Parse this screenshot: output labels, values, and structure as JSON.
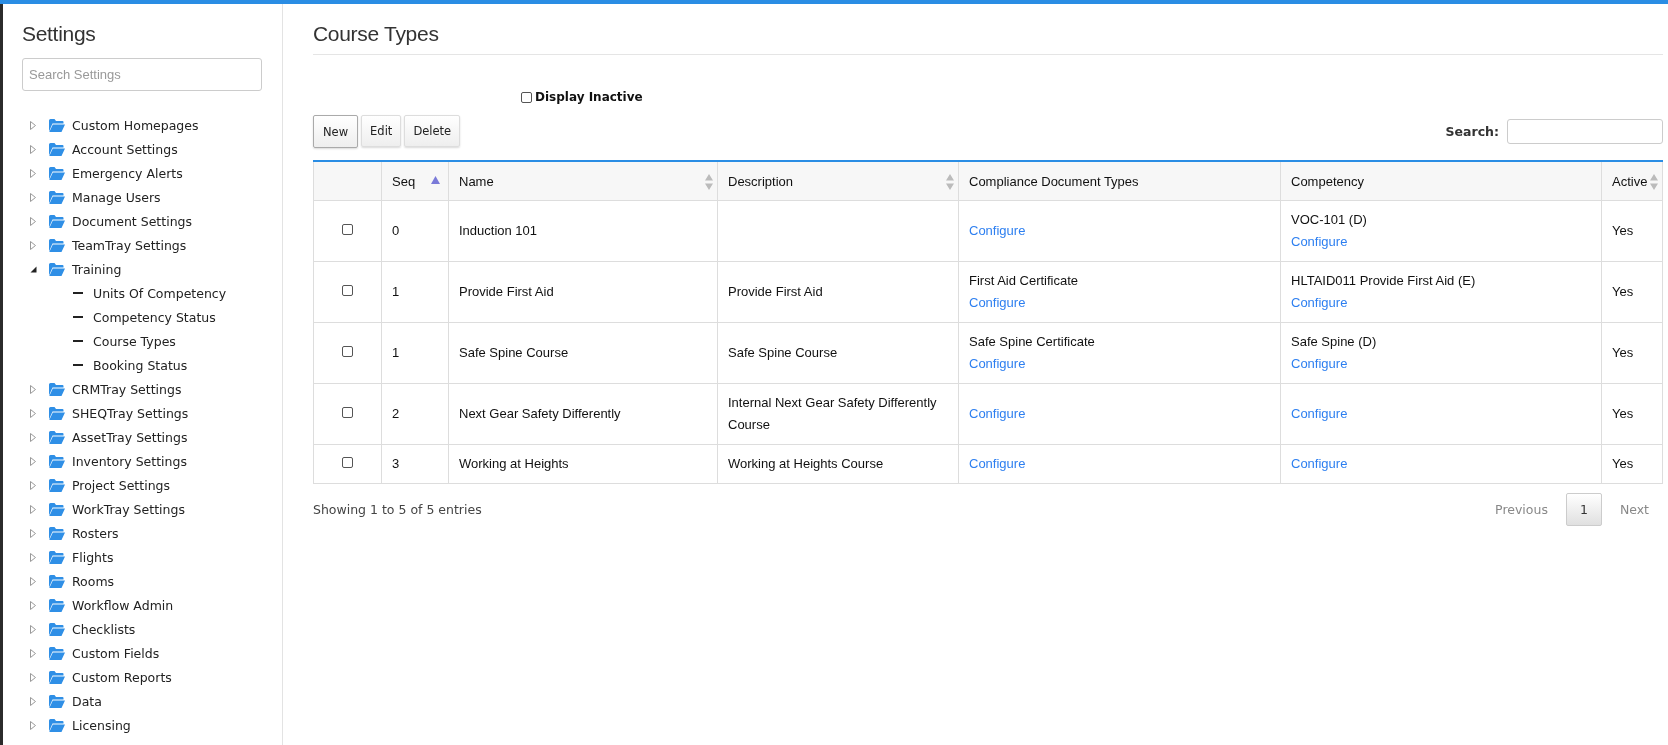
{
  "sidebar": {
    "title": "Settings",
    "search": {
      "placeholder": "Search Settings"
    },
    "items": [
      {
        "label": "Custom Homepages",
        "expanded": false
      },
      {
        "label": "Account Settings",
        "expanded": false
      },
      {
        "label": "Emergency Alerts",
        "expanded": false
      },
      {
        "label": "Manage Users",
        "expanded": false
      },
      {
        "label": "Document Settings",
        "expanded": false
      },
      {
        "label": "TeamTray Settings",
        "expanded": false
      },
      {
        "label": "Training",
        "expanded": true,
        "children": [
          {
            "label": "Units Of Competency"
          },
          {
            "label": "Competency Status"
          },
          {
            "label": "Course Types"
          },
          {
            "label": "Booking Status"
          }
        ]
      },
      {
        "label": "CRMTray Settings",
        "expanded": false
      },
      {
        "label": "SHEQTray Settings",
        "expanded": false
      },
      {
        "label": "AssetTray Settings",
        "expanded": false
      },
      {
        "label": "Inventory Settings",
        "expanded": false
      },
      {
        "label": "Project Settings",
        "expanded": false
      },
      {
        "label": "WorkTray Settings",
        "expanded": false
      },
      {
        "label": "Rosters",
        "expanded": false
      },
      {
        "label": "Flights",
        "expanded": false
      },
      {
        "label": "Rooms",
        "expanded": false
      },
      {
        "label": "Workflow Admin",
        "expanded": false
      },
      {
        "label": "Checklists",
        "expanded": false
      },
      {
        "label": "Custom Fields",
        "expanded": false
      },
      {
        "label": "Custom Reports",
        "expanded": false
      },
      {
        "label": "Data",
        "expanded": false
      },
      {
        "label": "Licensing",
        "expanded": false
      }
    ]
  },
  "main": {
    "title": "Course Types",
    "display_inactive": {
      "label": "Display Inactive",
      "checked": false
    },
    "buttons": [
      "New",
      "Edit",
      "Delete"
    ],
    "search": {
      "label": "Search:"
    },
    "table": {
      "columns": [
        {
          "sortable": false,
          "sorted": false
        },
        {
          "label": "Seq",
          "sortable": true,
          "sorted": true
        },
        {
          "label": "Name",
          "sortable": true,
          "sorted": false
        },
        {
          "label": "Description",
          "sortable": true,
          "sorted": false
        },
        {
          "label": "Compliance Document Types",
          "sortable": false,
          "sorted": false
        },
        {
          "label": "Competency",
          "sortable": false,
          "sorted": false
        },
        {
          "label": "Active",
          "sortable": true,
          "sorted": false
        }
      ],
      "rows": [
        {
          "selected": false,
          "seq": "0",
          "name": "Induction 101",
          "compliance": {
            "link": "Configure"
          },
          "competency": {
            "value": "VOC-101 (D)",
            "link": "Configure"
          },
          "active": "Yes"
        },
        {
          "selected": false,
          "seq": "1",
          "name": "Provide First Aid",
          "description": "Provide First Aid",
          "compliance": {
            "value": "First Aid Certificate",
            "link": "Configure"
          },
          "competency": {
            "value": "HLTAID011 Provide First Aid (E)",
            "link": "Configure"
          },
          "active": "Yes"
        },
        {
          "selected": false,
          "seq": "1",
          "name": "Safe Spine Course",
          "description": "Safe Spine Course",
          "compliance": {
            "value": "Safe Spine Certificate",
            "link": "Configure"
          },
          "competency": {
            "value": "Safe Spine (D)",
            "link": "Configure"
          },
          "active": "Yes"
        },
        {
          "selected": false,
          "seq": "2",
          "name": "Next Gear Safety Differently",
          "description": "Internal Next Gear Safety Differently Course",
          "compliance": {
            "link": "Configure"
          },
          "competency": {
            "link": "Configure"
          },
          "active": "Yes"
        },
        {
          "selected": false,
          "seq": "3",
          "name": "Working at Heights",
          "description": "Working at Heights Course",
          "compliance": {
            "link": "Configure"
          },
          "competency": {
            "link": "Configure"
          },
          "active": "Yes"
        }
      ]
    },
    "info": "Showing 1 to 5 of 5 entries",
    "pagination": [
      {
        "label": "Previous",
        "disabled": true,
        "selected": false
      },
      {
        "label": "1",
        "disabled": false,
        "selected": true
      },
      {
        "label": "Next",
        "disabled": true,
        "selected": false
      }
    ]
  }
}
